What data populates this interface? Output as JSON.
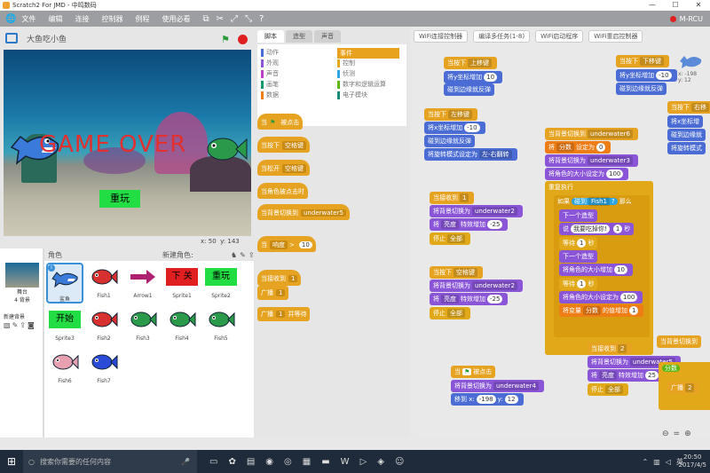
{
  "window": {
    "title": "Scratch2 For JMD - 中鸣数码"
  },
  "menu": {
    "items": [
      "文件",
      "编辑",
      "连接",
      "控制器",
      "例程",
      "使用必看"
    ],
    "device": "M-RCU"
  },
  "stage": {
    "title": "大鱼吃小鱼",
    "gameover": "GAME  OVER",
    "play": "重玩",
    "x_label": "x:",
    "x": "50",
    "y_label": "y:",
    "y": "143"
  },
  "sprites": {
    "header": "角色",
    "new_sprite": "新建角色:",
    "stage_label": "舞台",
    "stage_bg": "4 背景",
    "new_bg": "新建背景",
    "items": [
      {
        "name": "鲨鱼",
        "kind": "shark",
        "color": "#3a7ad8"
      },
      {
        "name": "Fish1",
        "kind": "fish",
        "color": "#d83030"
      },
      {
        "name": "Arrow1",
        "kind": "arrow",
        "color": "#b02070"
      },
      {
        "name": "Sprite1",
        "kind": "rect",
        "text": "下  关",
        "color": "#e02020"
      },
      {
        "name": "Sprite2",
        "kind": "rect",
        "text": "重玩",
        "color": "#22dd44"
      },
      {
        "name": "Sprite3",
        "kind": "rect",
        "text": "开始",
        "color": "#22dd44"
      },
      {
        "name": "Fish2",
        "kind": "fish",
        "color": "#d83030"
      },
      {
        "name": "Fish3",
        "kind": "fish",
        "color": "#2a9a4a"
      },
      {
        "name": "Fish4",
        "kind": "fish",
        "color": "#2a9a4a"
      },
      {
        "name": "Fish5",
        "kind": "fish",
        "color": "#2a9a4a"
      },
      {
        "name": "Fish6",
        "kind": "fish",
        "color": "#e8a0b0"
      },
      {
        "name": "Fish7",
        "kind": "fish",
        "color": "#2a4ad8"
      }
    ]
  },
  "palette": {
    "tabs": [
      "脚本",
      "造型",
      "声音"
    ],
    "categories_left": [
      "动作",
      "外观",
      "声音",
      "画笔",
      "数据"
    ],
    "categories_right": [
      "事件",
      "控制",
      "侦测",
      "数字和逻辑运算",
      "电子模块"
    ],
    "blocks": [
      {
        "t": "当",
        "flag": true,
        "rest": "被点击"
      },
      {
        "t": "当按下",
        "slot": "空格键"
      },
      {
        "t": "当松开",
        "slot": "空格键"
      },
      {
        "t": "当角色被点击时"
      },
      {
        "t": "当背景切换到",
        "slot": "underwater5"
      },
      {
        "t": "当",
        "slot": "响度",
        "rest2": ">",
        "num": "10"
      },
      {
        "t": "当接收到",
        "slot": "1"
      },
      {
        "t": "广播",
        "slot": "1"
      },
      {
        "t": "广播",
        "slot": "1",
        "rest": "并等待"
      }
    ]
  },
  "script_tabs": [
    "WiFi连接控制器",
    "编译多任务(1-8)",
    "WiFi启动程序",
    "WiFi重启控制器"
  ],
  "scripts": {
    "s1a": "当按下",
    "s1b": "上移键",
    "s1c": "将y坐标增加",
    "s1d": "10",
    "s1e": "碰到边缘就反弹",
    "s2a": "当按下",
    "s2b": "左移键",
    "s2c": "将x坐标增加",
    "s2d": "-10",
    "s2e": "碰到边缘就反弹",
    "s2f": "将旋转模式设定为",
    "s2g": "左-右翻转",
    "s3a": "当接收到",
    "s3b": "1",
    "s3c": "将背景切换为",
    "s3d": "underwater2",
    "s3e": "将",
    "s3f": "亮度",
    "s3g": "特效增加",
    "s3h": "-25",
    "s3i": "停止",
    "s3j": "全部",
    "s4a": "当按下",
    "s4b": "空格键",
    "s4c": "将背景切换为",
    "s4d": "underwater2",
    "s4e": "将",
    "s4f": "亮度",
    "s4g": "特效增加",
    "s4h": "-25",
    "s4i": "停止",
    "s4j": "全部",
    "s5a": "当",
    "s5b": "被点击",
    "s5c": "将背景切换为",
    "s5d": "underwater4",
    "s5e": "移到 x:",
    "s5f": "-198",
    "s5g": "y:",
    "s5h": "12",
    "s6a": "当背景切换到",
    "s6b": "underwater6",
    "s6c": "将",
    "s6d": "分数",
    "s6e": "设定为",
    "s6f": "0",
    "s6g": "将背景切换为",
    "s6h": "underwater3",
    "s6i": "将角色的大小设定为",
    "s6j": "100",
    "s6k": "重复执行",
    "s6l": "如果",
    "s6m": "碰到",
    "s6n": "Fish1",
    "s6o": "?",
    "s6p": "那么",
    "s6q": "下一个造型",
    "s6r": "说",
    "s6s": "我要吃掉你!",
    "s6t": "1",
    "s6u": "秒",
    "s6v": "等待",
    "s6w": "1",
    "s6x": "秒",
    "s6y": "下一个造型",
    "s6z": "将角色的大小增加",
    "s6aa": "10",
    "s6ab": "等待",
    "s6ac": "1",
    "s6ad": "秒",
    "s6ae": "将角色的大小设定为",
    "s6af": "100",
    "s6ag": "将变量",
    "s6ah": "分数",
    "s6ai": "的值增加",
    "s6aj": "1",
    "s7a": "当按下",
    "s7b": "下移键",
    "s7c": "将y坐标增加",
    "s7d": "-10",
    "s7e": "碰到边缘就反弹",
    "s8a": "当按下",
    "s8b": "右移",
    "s8c": "将x坐标增",
    "s8d": "碰到边缘就",
    "s8e": "将旋转模式",
    "s9a": "当接收到",
    "s9b": "2",
    "s9c": "将背景切换为",
    "s9d": "underwater5",
    "s9e": "将",
    "s9f": "亮度",
    "s9g": "特效增加",
    "s9h": "25",
    "s9i": "停止",
    "s9j": "全部",
    "s10a": "当背景切换到",
    "s10b": "分数",
    "s10c": "广播",
    "s10d": "2",
    "coord_x": "x: -198",
    "coord_y": "y: 12"
  },
  "taskbar": {
    "search": "搜索你需要的任何内容",
    "time": "20:50",
    "date": "2017/4/5",
    "lang": "英"
  }
}
